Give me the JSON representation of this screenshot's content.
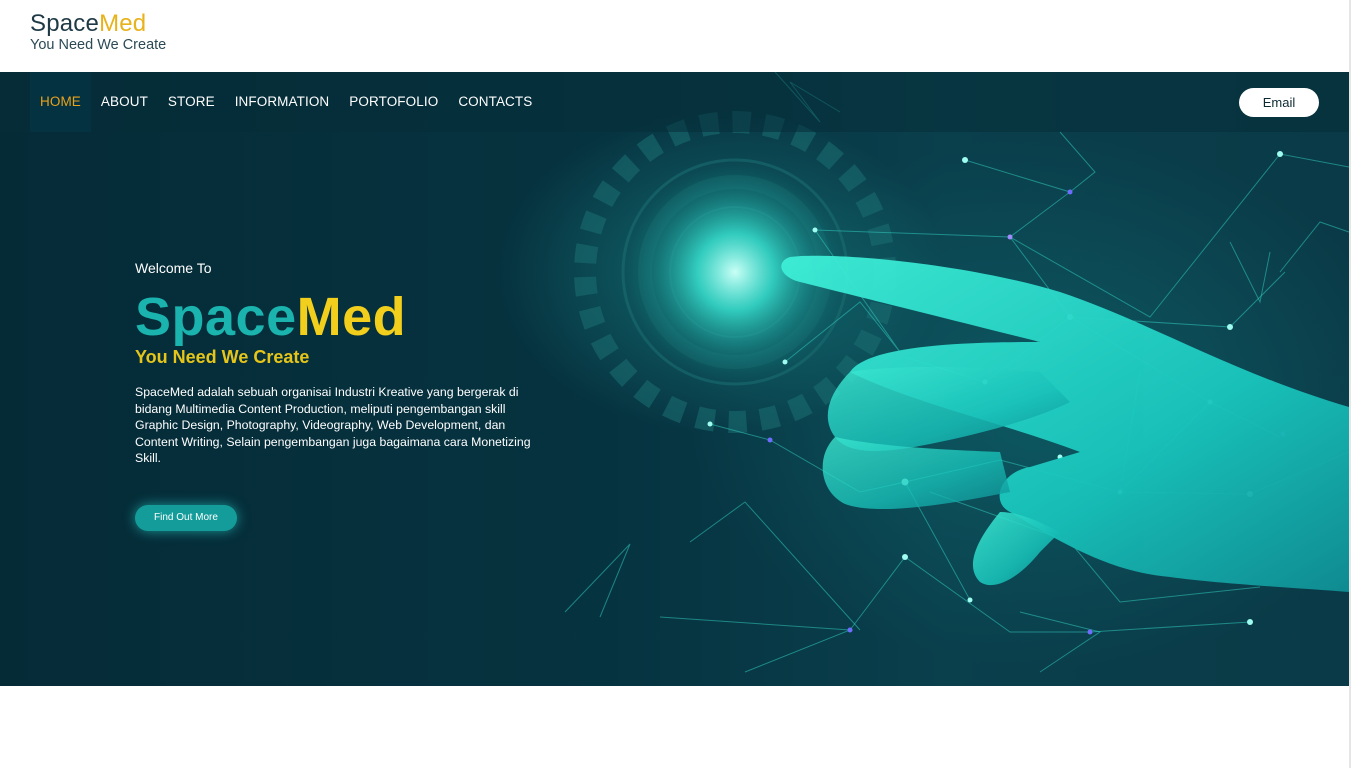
{
  "brand": {
    "name_part1": "Space",
    "name_part2": "Med",
    "tagline": "You Need We Create"
  },
  "nav": {
    "items": [
      {
        "label": "HOME",
        "active": true
      },
      {
        "label": "ABOUT"
      },
      {
        "label": "STORE"
      },
      {
        "label": "INFORMATION"
      },
      {
        "label": "PORTOFOLIO"
      },
      {
        "label": "CONTACTS"
      }
    ],
    "email_label": "Email"
  },
  "hero": {
    "welcome": "Welcome To",
    "title_part1": "Space",
    "title_part2": "Med",
    "tagline": "You Need We Create",
    "description": "SpaceMed adalah sebuah organisai Industri Kreative yang bergerak di bidang Multimedia Content Production, meliputi pengembangan skill Graphic Design, Photography, Videography, Web Development, dan Content Writing, Selain pengembangan juga bagaimana cara Monetizing Skill.",
    "cta_label": "Find Out More"
  },
  "colors": {
    "accent_yellow": "#f2cf1d",
    "accent_teal": "#1ab3ad",
    "nav_active": "#e8a21c",
    "hero_bg": "#063340"
  }
}
